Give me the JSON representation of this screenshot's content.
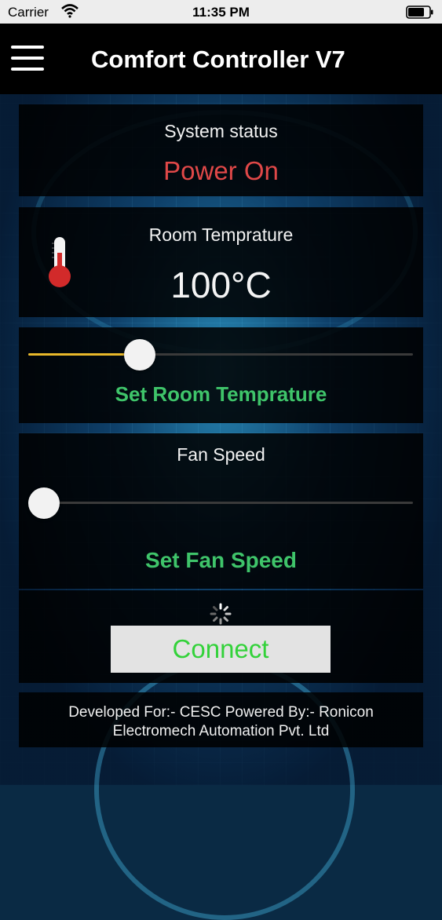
{
  "statusbar": {
    "carrier": "Carrier",
    "time": "11:35 PM"
  },
  "header": {
    "title": "Comfort Controller V7",
    "menu_icon": "hamburger-menu-icon"
  },
  "system_status": {
    "label": "System status",
    "value": "Power On",
    "value_color": "#e04848"
  },
  "room_temperature": {
    "label": "Room Temprature",
    "value": "100°C",
    "icon": "thermometer-icon"
  },
  "set_temperature": {
    "label": "Set Room Temprature",
    "slider_fraction": 0.27,
    "fill_color": "#e8b82a"
  },
  "fan_speed": {
    "label": "Fan Speed",
    "slider_fraction": 0.0,
    "set_label": "Set Fan Speed"
  },
  "connect": {
    "label": "Connect",
    "spinner_icon": "loading-spinner-icon"
  },
  "footer": {
    "line1": "Developed For:- CESC Powered By:- Ronicon",
    "line2": "Electromech Automation Pvt. Ltd"
  },
  "colors": {
    "accent_green": "#3fc46a",
    "button_text": "#33d23a"
  }
}
